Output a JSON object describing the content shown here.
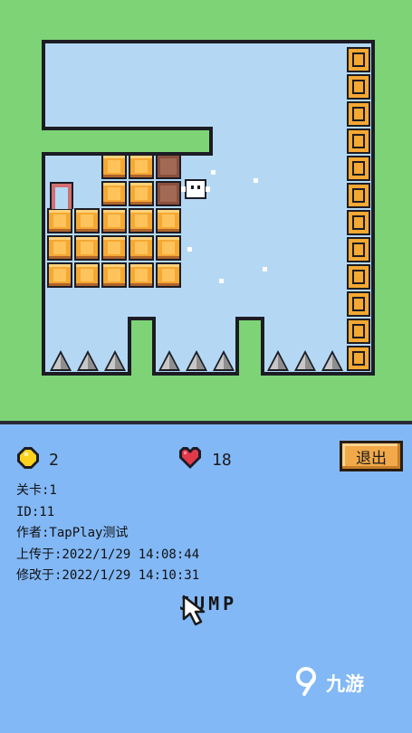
{
  "game": {
    "colors": {
      "grass": "#7dd376",
      "sky": "#b4d8f4",
      "outline": "#1c1c24",
      "block": "#f5a832",
      "block_light": "#ffd27a",
      "block_dark": "#b0652b",
      "crate": "#8a4f3c",
      "spike": "#c7c7c7",
      "door": "#d07070"
    }
  },
  "hud": {
    "coins": {
      "icon": "coin-icon",
      "value": "2"
    },
    "lives": {
      "icon": "heart-icon",
      "value": "18"
    },
    "exit_label": "退出"
  },
  "level_info": {
    "level": "关卡:1",
    "id": "ID:11",
    "author": "作者:TapPlay测试",
    "uploaded": "上传于:2022/1/29 14:08:44",
    "modified": "修改于:2022/1/29 14:10:31"
  },
  "jump_label": "JUMP",
  "watermark": "九游"
}
